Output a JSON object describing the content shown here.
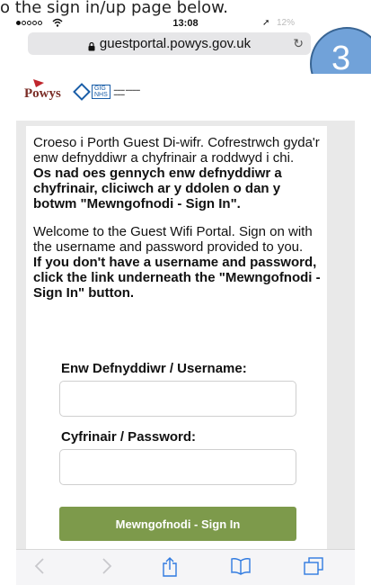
{
  "caption": "o the sign in/up page below.",
  "statusbar": {
    "signal_dots": 5,
    "signal_on": 1,
    "time": "13:08",
    "battery": "12%"
  },
  "address": {
    "domain": "guestportal.powys.gov.uk"
  },
  "callout": {
    "number": "3",
    "color": "#6a9ed7"
  },
  "logos": {
    "powys": "Powys",
    "nhs_gig": "GIG",
    "nhs_nhs": "NHS"
  },
  "intro": {
    "welsh_line": "Croeso i Porth Guest Di-wifr. Cofrestrwch gyda'r enw defnyddiwr a chyfrinair a roddwyd i chi.",
    "welsh_bold": "Os nad oes gennych enw defnyddiwr a chyfrinair, cliciwch ar y ddolen o dan y botwm \"Mewngofnodi - Sign In\".",
    "english_line": "Welcome to the Guest Wifi Portal. Sign on with the username and password provided to you.",
    "english_bold": "If you don't have a username and password, click the link underneath the \"Mewngofnodi - Sign In\" button."
  },
  "form": {
    "username_label": "Enw Defnyddiwr / Username:",
    "username_value": "",
    "password_label": "Cyfrinair / Password:",
    "password_value": "",
    "signin_label": "Mewngofnodi - Sign In",
    "signin_color": "#7d9a4b"
  },
  "toolbar": {
    "back_icon": "chevron-left-icon",
    "forward_icon": "chevron-right-icon",
    "share_icon": "share-icon",
    "bookmarks_icon": "book-icon",
    "tabs_icon": "tabs-icon"
  }
}
